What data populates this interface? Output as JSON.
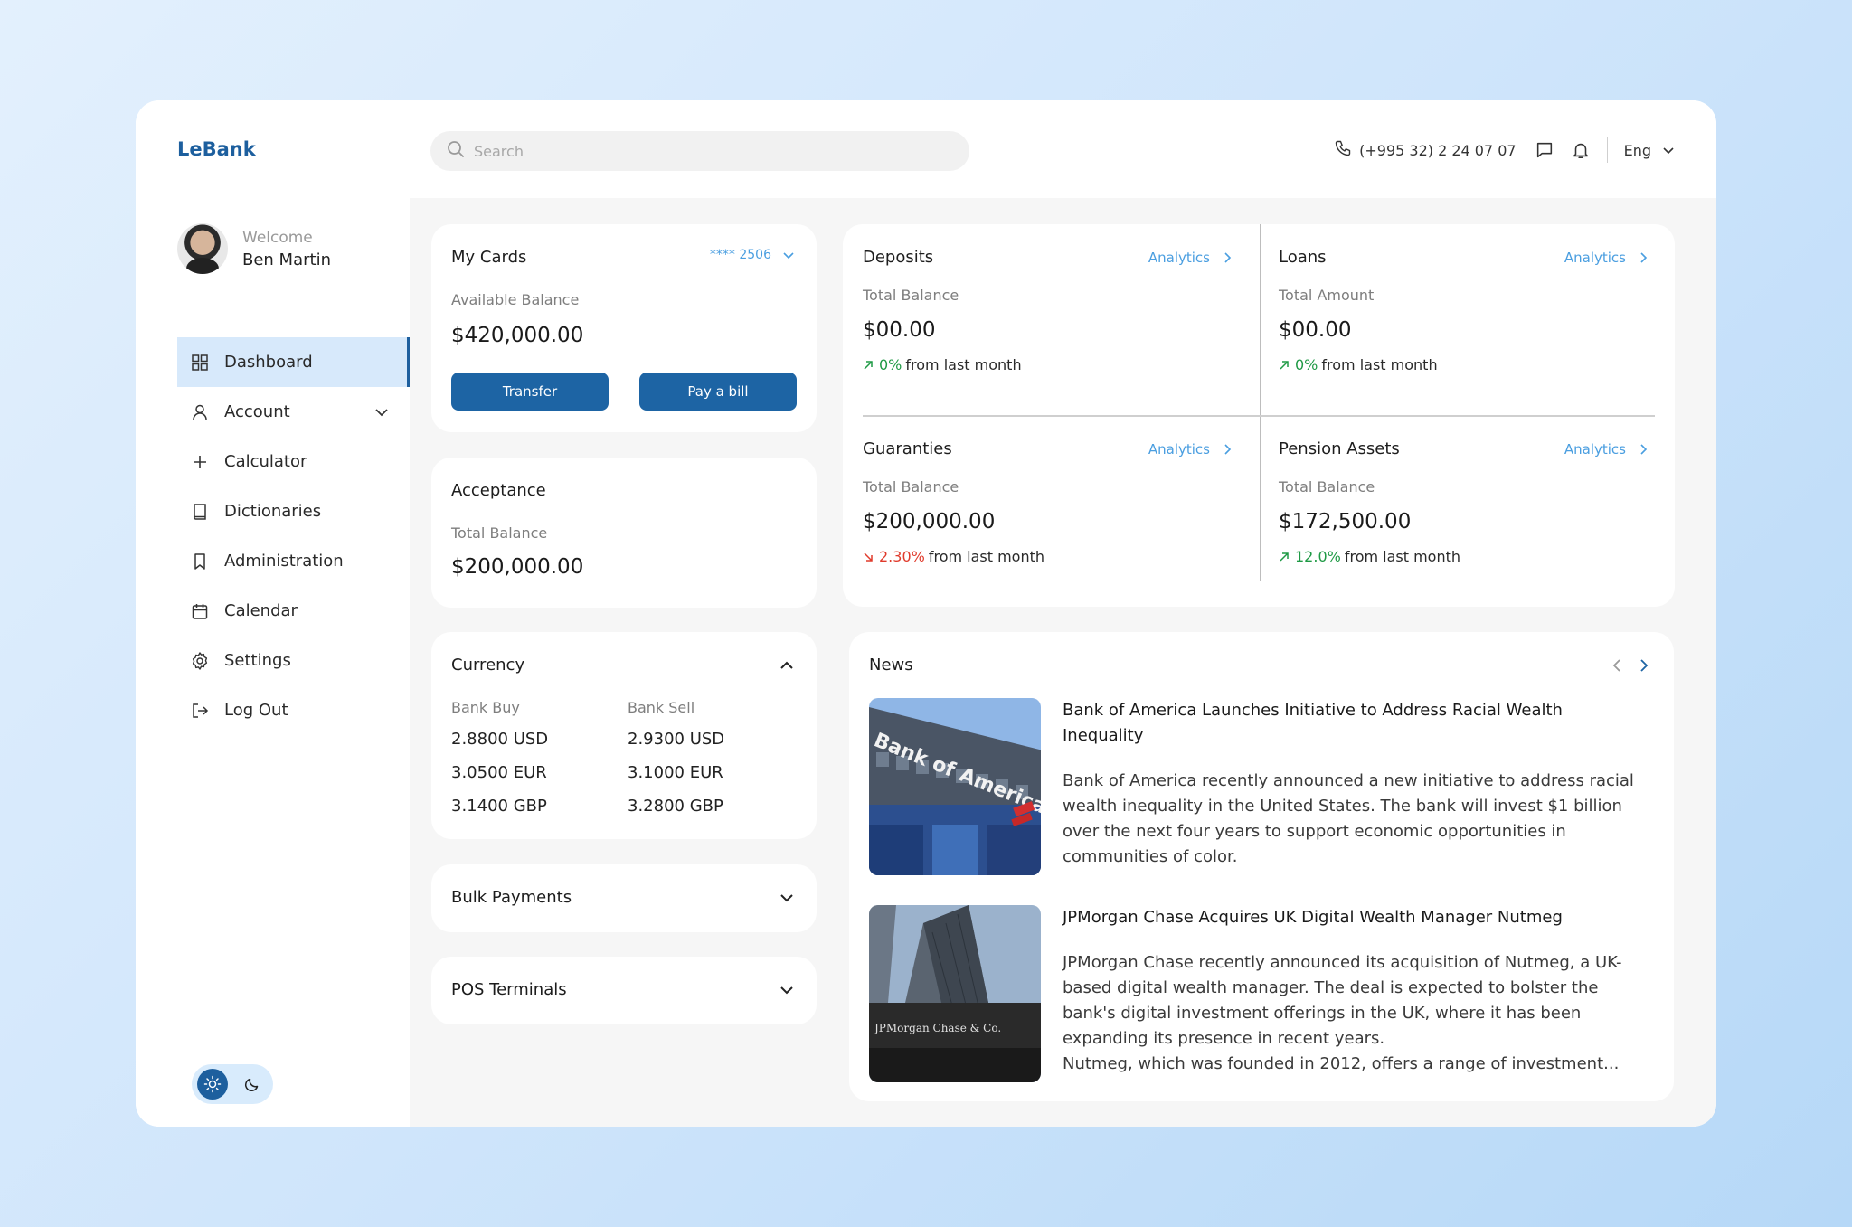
{
  "app": {
    "name": "LeBank"
  },
  "search": {
    "placeholder": "Search"
  },
  "topbar": {
    "phone": "(+995 32) 2 24 07 07",
    "language": "Eng"
  },
  "user": {
    "greeting": "Welcome",
    "name": "Ben Martin"
  },
  "sidebar": {
    "items": [
      {
        "label": "Dashboard",
        "icon": "grid-icon"
      },
      {
        "label": "Account",
        "icon": "user-icon"
      },
      {
        "label": "Calculator",
        "icon": "plus-icon"
      },
      {
        "label": "Dictionaries",
        "icon": "book-icon"
      },
      {
        "label": "Administration",
        "icon": "bookmark-icon"
      },
      {
        "label": "Calendar",
        "icon": "calendar-icon"
      },
      {
        "label": "Settings",
        "icon": "gear-icon"
      },
      {
        "label": "Log Out",
        "icon": "logout-icon"
      }
    ]
  },
  "my_cards": {
    "title": "My Cards",
    "card_number": "**** 2506",
    "balance_label": "Available Balance",
    "balance": "$420,000.00",
    "transfer_label": "Transfer",
    "pay_label": "Pay a bill"
  },
  "acceptance": {
    "title": "Acceptance",
    "label": "Total Balance",
    "value": "$200,000.00"
  },
  "currency": {
    "title": "Currency",
    "buy_header": "Bank Buy",
    "sell_header": "Bank Sell",
    "rows": [
      {
        "buy": "2.8800 USD",
        "sell": "2.9300 USD"
      },
      {
        "buy": "3.0500 EUR",
        "sell": "3.1000 EUR"
      },
      {
        "buy": "3.1400 GBP",
        "sell": "3.2800 GBP"
      }
    ]
  },
  "bulk_payments": {
    "title": "Bulk Payments"
  },
  "pos_terminals": {
    "title": "POS Terminals"
  },
  "overview": {
    "analytics_label": "Analytics",
    "suffix": "from last month",
    "deposits": {
      "title": "Deposits",
      "label": "Total Balance",
      "value": "$00.00",
      "change": "0%",
      "trend": "up"
    },
    "loans": {
      "title": "Loans",
      "label": "Total Amount",
      "value": "$00.00",
      "change": "0%",
      "trend": "up"
    },
    "guarantees": {
      "title": "Guaranties",
      "label": "Total Balance",
      "value": "$200,000.00",
      "change": "2.30%",
      "trend": "down"
    },
    "pension": {
      "title": "Pension Assets",
      "label": "Total Balance",
      "value": "$172,500.00",
      "change": "12.0%",
      "trend": "up"
    }
  },
  "news": {
    "title": "News",
    "items": [
      {
        "title": "Bank of America Launches Initiative to Address Racial Wealth Inequality",
        "body": "Bank of America recently announced a new initiative to address racial wealth inequality in the United States. The bank will invest $1 billion over the next four years to support economic opportunities in communities of color.",
        "image_sign": "Bank of America"
      },
      {
        "title": "JPMorgan Chase Acquires UK Digital Wealth Manager Nutmeg",
        "body": "JPMorgan Chase recently announced its acquisition of Nutmeg, a UK-based digital wealth manager. The deal is expected to bolster the bank's digital investment offerings in the UK, where it has been expanding its presence in recent years.",
        "body2": "Nutmeg, which was founded in 2012, offers a range of investment...",
        "image_sign": "JPMorgan Chase & Co."
      }
    ]
  },
  "colors": {
    "brand": "#1d5f9e",
    "accent": "#4a9ee0",
    "positive": "#1f9a45",
    "negative": "#e03b2c"
  }
}
